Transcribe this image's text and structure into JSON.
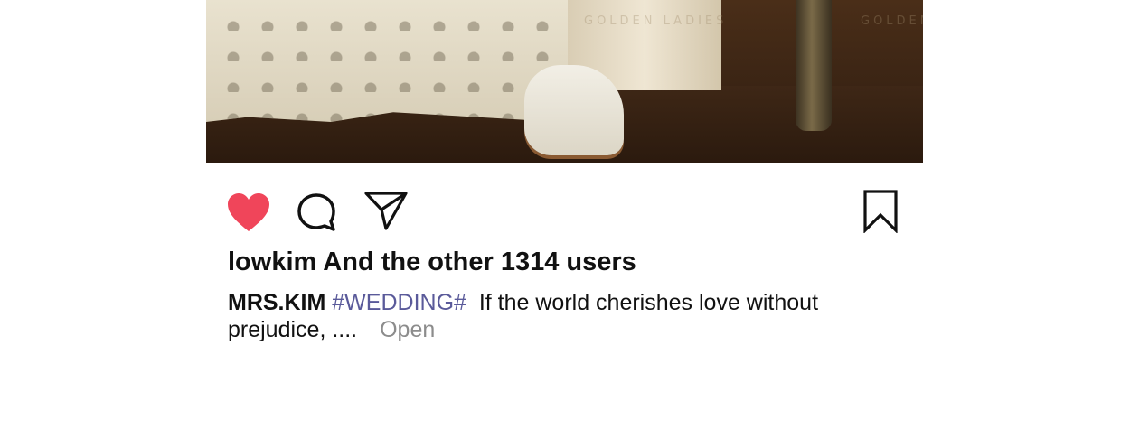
{
  "post": {
    "image": {
      "watermark_left": "GOLDEN LADIES",
      "watermark_right": "GOLDEN"
    },
    "actions": {
      "like_icon": "heart-icon",
      "like_color": "#f0455a",
      "comment_icon": "comment-bubble-icon",
      "share_icon": "send-icon",
      "save_icon": "bookmark-icon"
    },
    "likes_text": "lowkim And the other 1314 users",
    "caption": {
      "username": "MRS.KIM",
      "hashtag": "#WEDDING#",
      "text": "If the world cherishes love without prejudice, ....",
      "more_label": "Open"
    }
  }
}
